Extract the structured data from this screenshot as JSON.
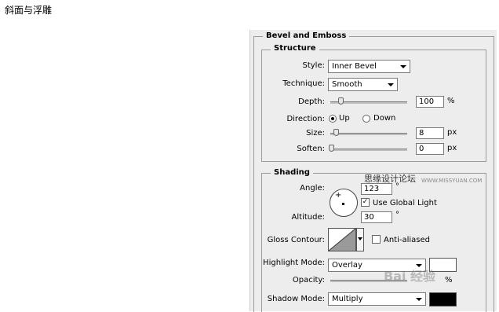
{
  "caption": "斜面与浮雕",
  "panel": {
    "title": "Bevel and Emboss",
    "structure": {
      "title": "Structure",
      "style_label": "Style:",
      "style_value": "Inner Bevel",
      "technique_label": "Technique:",
      "technique_value": "Smooth",
      "depth_label": "Depth:",
      "depth_value": "100",
      "depth_unit": "%",
      "depth_level": 0.1,
      "direction_label": "Direction:",
      "direction_up": "Up",
      "direction_down": "Down",
      "direction_selected": "Up",
      "size_label": "Size:",
      "size_value": "8",
      "size_unit": "px",
      "soften_label": "Soften:",
      "soften_value": "0",
      "soften_unit": "px"
    },
    "shading": {
      "title": "Shading",
      "angle_label": "Angle:",
      "angle_value": "123",
      "angle_unit": "°",
      "use_global_light_label": "Use Global Light",
      "use_global_light_checked": true,
      "altitude_label": "Altitude:",
      "altitude_value": "30",
      "altitude_unit": "°",
      "gloss_contour_label": "Gloss Contour:",
      "anti_aliased_label": "Anti-aliased",
      "anti_aliased_checked": false,
      "highlight_mode_label": "Highlight Mode:",
      "highlight_mode_value": "Overlay",
      "highlight_color": "#ffffff",
      "opacity_label": "Opacity:",
      "opacity_unit": "%",
      "shadow_mode_label": "Shadow Mode:",
      "shadow_mode_value": "Multiply",
      "shadow_color": "#000000"
    }
  },
  "watermarks": {
    "site_cn": "思缘设计论坛",
    "site_url": "WWW.MISSYUAN.COM",
    "baidu": "Bai 经验"
  }
}
